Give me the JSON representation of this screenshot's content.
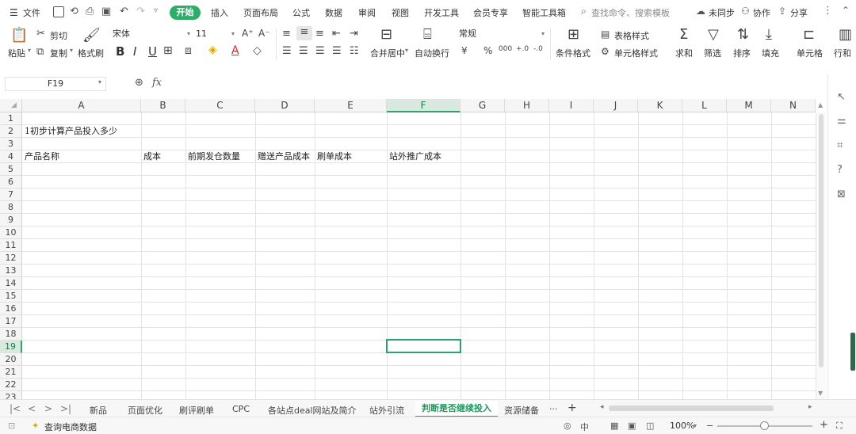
{
  "menubar": {
    "file_label": "文件",
    "tabs": [
      "开始",
      "插入",
      "页面布局",
      "公式",
      "数据",
      "审阅",
      "视图",
      "开发工具",
      "会员专享",
      "智能工具箱"
    ],
    "search_placeholder": "查找命令、搜索模板",
    "sync_label": "未同步",
    "collab_label": "协作",
    "share_label": "分享"
  },
  "ribbon": {
    "paste_label": "粘贴",
    "cut_label": "剪切",
    "copy_label": "复制",
    "format_painter_label": "格式刷",
    "font_name": "宋体",
    "font_size": "11",
    "bold": "B",
    "italic": "I",
    "underline": "U",
    "merge_center_label": "合并居中",
    "wrap_label": "自动换行",
    "number_format": "常规",
    "currency_symbol": "¥",
    "percent_symbol": "%",
    "thousands_symbol": "000",
    "dec_increase": "+.0",
    "dec_decrease": "-.0",
    "cond_format_label": "条件格式",
    "table_style_label": "表格样式",
    "cell_style_label": "单元格样式",
    "sum_label": "求和",
    "filter_label": "筛选",
    "sort_label": "排序",
    "fill_label": "填充",
    "cell_label": "单元格",
    "rowcol_label": "行和"
  },
  "formula_bar": {
    "cell_ref": "F19",
    "fx_label": "fx",
    "value": ""
  },
  "grid": {
    "columns": [
      "A",
      "B",
      "C",
      "D",
      "E",
      "F",
      "G",
      "H",
      "I",
      "J",
      "K",
      "L",
      "M",
      "N"
    ],
    "rows": [
      "1",
      "2",
      "3",
      "4",
      "5",
      "6",
      "7",
      "8",
      "9",
      "10",
      "11",
      "12",
      "13",
      "14",
      "15",
      "16",
      "17",
      "18",
      "19",
      "20",
      "21",
      "22",
      "23"
    ],
    "selected_cell": "F19",
    "cells": {
      "A2": "1初步计算产品投入多少",
      "A4": "产品名称",
      "B4": "成本",
      "C4": "前期发仓数量",
      "D4": "赠送产品成本",
      "E4": "刷单成本",
      "F4": "站外推广成本"
    }
  },
  "sheets": {
    "tabs": [
      "新品",
      "页面优化",
      "刷评刷单",
      "CPC",
      "各站点deal网站及简介",
      "站外引流",
      "判断是否继续投入",
      "资源储备"
    ],
    "active": "判断是否继续投入",
    "more_label": "···",
    "add_label": "+"
  },
  "statusbar": {
    "left_label": "查询电商数据",
    "zoom": "100%"
  },
  "colors": {
    "accent": "#2aa46a",
    "active_tab_bg": "#2cae6a"
  }
}
